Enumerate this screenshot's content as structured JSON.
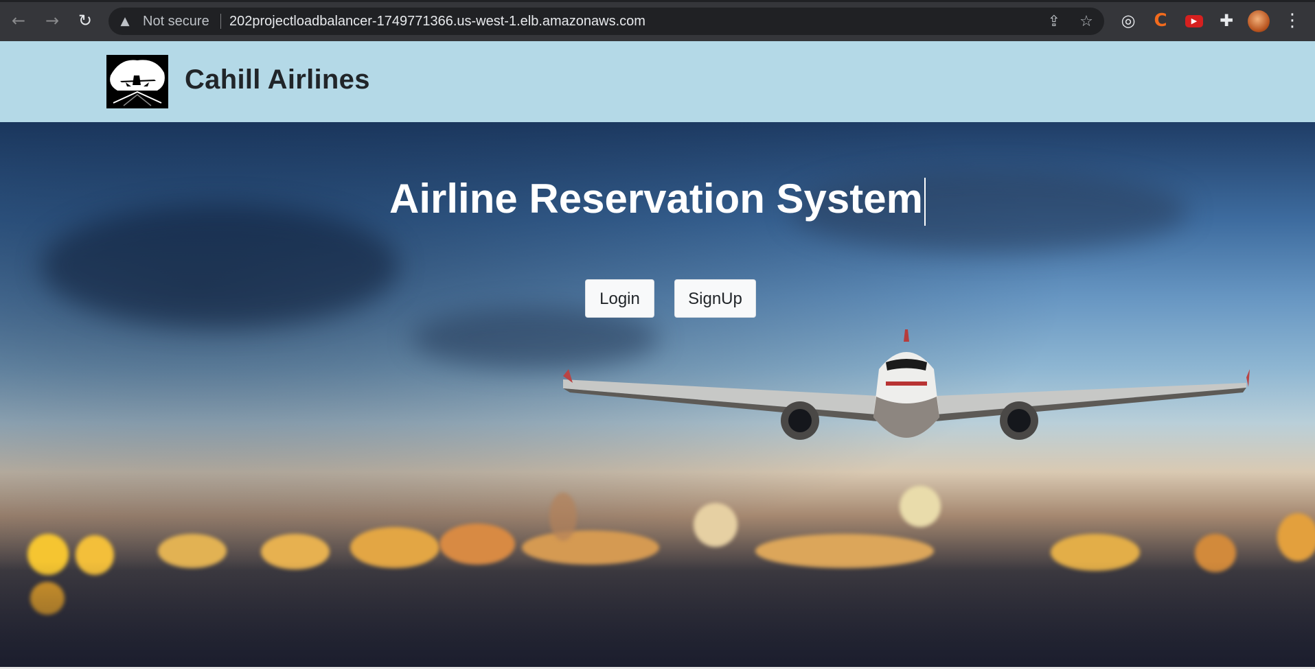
{
  "browser": {
    "security_label": "Not secure",
    "url": "202projectloadbalancer-1749771366.us-west-1.elb.amazonaws.com",
    "icons": [
      "back-icon",
      "forward-icon",
      "reload-icon",
      "warning-icon",
      "share-icon",
      "star-icon",
      "extension-target-icon",
      "extension-c-icon",
      "extension-youtube-icon",
      "puzzle-icon",
      "profile-avatar",
      "menu-icon"
    ],
    "glyphs": {
      "back": "←",
      "forward": "→",
      "reload": "↻",
      "warning": "▲",
      "share": "⇪",
      "star": "☆",
      "target": "◎",
      "c_ext": "C",
      "youtube": "▶",
      "puzzle": "✚",
      "menu": "⋮"
    }
  },
  "header": {
    "brand": "Cahill Airlines",
    "background_color": "#b4d9e7"
  },
  "hero": {
    "title": "Airline Reservation System",
    "buttons": {
      "login": "Login",
      "signup": "SignUp"
    }
  }
}
